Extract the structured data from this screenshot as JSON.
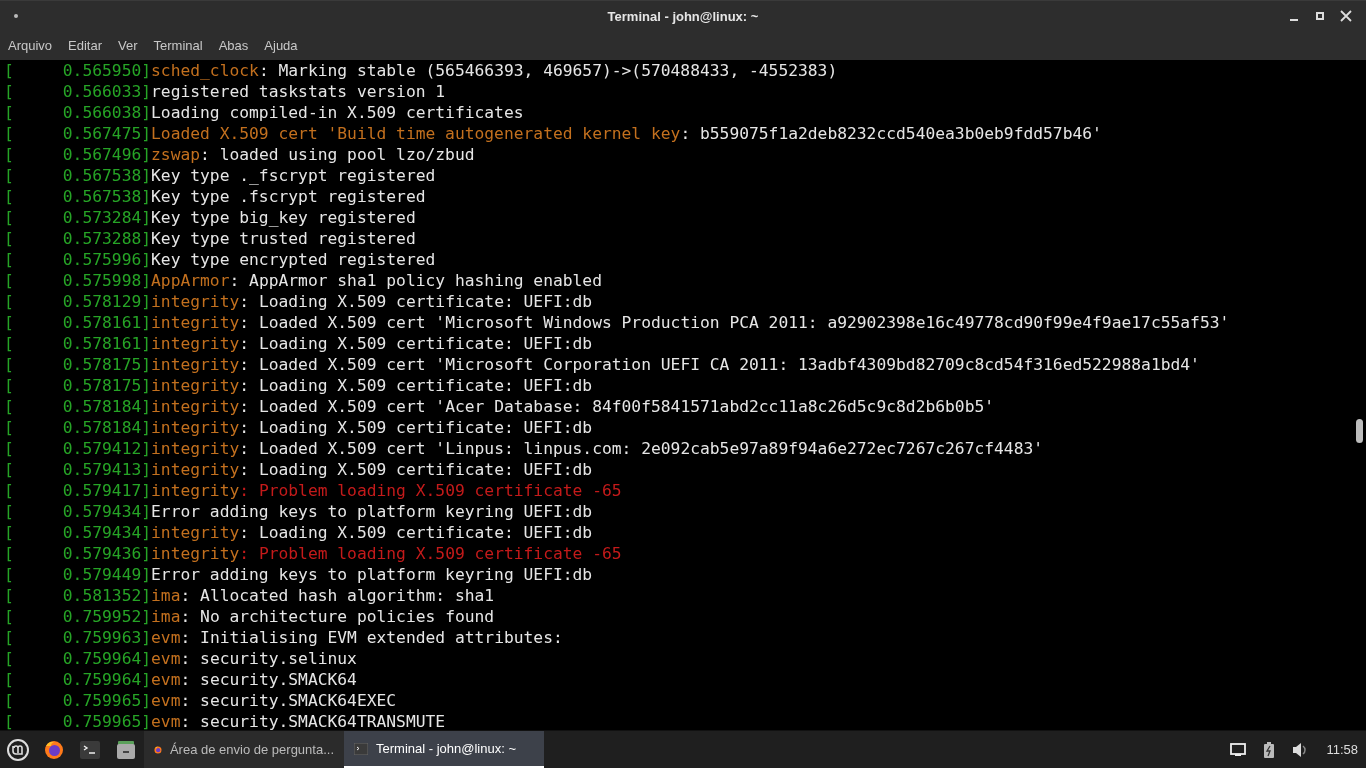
{
  "window": {
    "title": "Terminal - john@linux: ~"
  },
  "menu": [
    "Arquivo",
    "Editar",
    "Ver",
    "Terminal",
    "Abas",
    "Ajuda"
  ],
  "lines": [
    {
      "time": "[     0.565950]",
      "source": "sched_clock",
      "message": ": Marking stable (565466393, 469657)->(570488433, -4552383)",
      "kind": "info"
    },
    {
      "time": "[     0.566033]",
      "message": "registered taskstats version 1",
      "kind": "info"
    },
    {
      "time": "[     0.566038]",
      "message": "Loading compiled-in X.509 certificates",
      "kind": "info"
    },
    {
      "time": "[     0.567475]",
      "source": "Loaded X.509 cert 'Build time autogenerated kernel key",
      "message": ": b559075f1a2deb8232ccd540ea3b0eb9fdd57b46'",
      "kind": "info"
    },
    {
      "time": "[     0.567496]",
      "source": "zswap",
      "message": ": loaded using pool lzo/zbud",
      "kind": "info"
    },
    {
      "time": "[     0.567538]",
      "message": "Key type ._fscrypt registered",
      "kind": "info"
    },
    {
      "time": "[     0.567538]",
      "message": "Key type .fscrypt registered",
      "kind": "info"
    },
    {
      "time": "[     0.573284]",
      "message": "Key type big_key registered",
      "kind": "info"
    },
    {
      "time": "[     0.573288]",
      "message": "Key type trusted registered",
      "kind": "info"
    },
    {
      "time": "[     0.575996]",
      "message": "Key type encrypted registered",
      "kind": "info"
    },
    {
      "time": "[     0.575998]",
      "source": "AppArmor",
      "message": ": AppArmor sha1 policy hashing enabled",
      "kind": "info"
    },
    {
      "time": "[     0.578129]",
      "source": "integrity",
      "message": ": Loading X.509 certificate: UEFI:db",
      "kind": "info"
    },
    {
      "time": "[     0.578161]",
      "source": "integrity",
      "message": ": Loaded X.509 cert 'Microsoft Windows Production PCA 2011: a92902398e16c49778cd90f99e4f9ae17c55af53'",
      "kind": "info"
    },
    {
      "time": "[     0.578161]",
      "source": "integrity",
      "message": ": Loading X.509 certificate: UEFI:db",
      "kind": "info"
    },
    {
      "time": "[     0.578175]",
      "source": "integrity",
      "message": ": Loaded X.509 cert 'Microsoft Corporation UEFI CA 2011: 13adbf4309bd82709c8cd54f316ed522988a1bd4'",
      "kind": "info"
    },
    {
      "time": "[     0.578175]",
      "source": "integrity",
      "message": ": Loading X.509 certificate: UEFI:db",
      "kind": "info"
    },
    {
      "time": "[     0.578184]",
      "source": "integrity",
      "message": ": Loaded X.509 cert 'Acer Database: 84f00f5841571abd2cc11a8c26d5c9c8d2b6b0b5'",
      "kind": "info"
    },
    {
      "time": "[     0.578184]",
      "source": "integrity",
      "message": ": Loading X.509 certificate: UEFI:db",
      "kind": "info"
    },
    {
      "time": "[     0.579412]",
      "source": "integrity",
      "message": ": Loaded X.509 cert 'Linpus: linpus.com: 2e092cab5e97a89f94a6e272ec7267c267cf4483'",
      "kind": "info"
    },
    {
      "time": "[     0.579413]",
      "source": "integrity",
      "message": ": Loading X.509 certificate: UEFI:db",
      "kind": "info"
    },
    {
      "time": "[     0.579417]",
      "source": "integrity",
      "message": ": Problem loading X.509 certificate -65",
      "kind": "error"
    },
    {
      "time": "[     0.579434]",
      "message": "Error adding keys to platform keyring UEFI:db",
      "kind": "info"
    },
    {
      "time": "[     0.579434]",
      "source": "integrity",
      "message": ": Loading X.509 certificate: UEFI:db",
      "kind": "info"
    },
    {
      "time": "[     0.579436]",
      "source": "integrity",
      "message": ": Problem loading X.509 certificate -65",
      "kind": "error"
    },
    {
      "time": "[     0.579449]",
      "message": "Error adding keys to platform keyring UEFI:db",
      "kind": "info"
    },
    {
      "time": "[     0.581352]",
      "source": "ima",
      "message": ": Allocated hash algorithm: sha1",
      "kind": "info"
    },
    {
      "time": "[     0.759952]",
      "source": "ima",
      "message": ": No architecture policies found",
      "kind": "info"
    },
    {
      "time": "[     0.759963]",
      "source": "evm",
      "message": ": Initialising EVM extended attributes:",
      "kind": "info"
    },
    {
      "time": "[     0.759964]",
      "source": "evm",
      "message": ": security.selinux",
      "kind": "info"
    },
    {
      "time": "[     0.759964]",
      "source": "evm",
      "message": ": security.SMACK64",
      "kind": "info"
    },
    {
      "time": "[     0.759965]",
      "source": "evm",
      "message": ": security.SMACK64EXEC",
      "kind": "info"
    },
    {
      "time": "[     0.759965]",
      "source": "evm",
      "message": ": security.SMACK64TRANSMUTE",
      "kind": "info"
    }
  ],
  "taskbar": {
    "launchers": [
      {
        "kind": "menu"
      },
      {
        "kind": "firefox"
      },
      {
        "kind": "terminal"
      },
      {
        "kind": "files"
      }
    ],
    "windows": [
      {
        "kind": "firefox",
        "label": "Área de envio de pergunta...",
        "selected": false
      },
      {
        "kind": "terminal",
        "label": "Terminal - john@linux: ~",
        "selected": true
      }
    ],
    "clock": "11:58"
  }
}
